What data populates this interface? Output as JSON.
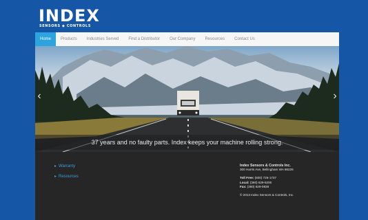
{
  "brand": {
    "logo_word": "INDEX",
    "logo_sub": "SENSORS ◆ CONTROLS"
  },
  "nav": {
    "items": [
      {
        "label": "Home"
      },
      {
        "label": "Products"
      },
      {
        "label": "Industries Served"
      },
      {
        "label": "Find a Distributor"
      },
      {
        "label": "Our Company"
      },
      {
        "label": "Resources"
      },
      {
        "label": "Contact Us"
      }
    ],
    "active_index": 0
  },
  "hero": {
    "caption": "37 years and no faulty parts. Index keeps your machine rolling strong.",
    "prev_icon": "chevron-left-icon",
    "next_icon": "chevron-right-icon"
  },
  "footer": {
    "links": [
      {
        "label": "Warranty"
      },
      {
        "label": "Resources"
      }
    ],
    "company_name": "Index Sensors & Controls Inc.",
    "address": "300 Harris Ave, Bellingham WA 98225",
    "toll_free_label": "Toll Free:",
    "toll_free": "(800) 726-1737",
    "local_label": "Local:",
    "local": "(360) 629-5200",
    "fax_label": "Fax:",
    "fax": "(360) 629-0838",
    "copyright": "© 2013 Index Sensors & Controls, Inc."
  },
  "colors": {
    "background": "#1556a6",
    "nav_active": "#2ba4e0",
    "footer_bg": "#262626",
    "link": "#3c9fdb"
  }
}
